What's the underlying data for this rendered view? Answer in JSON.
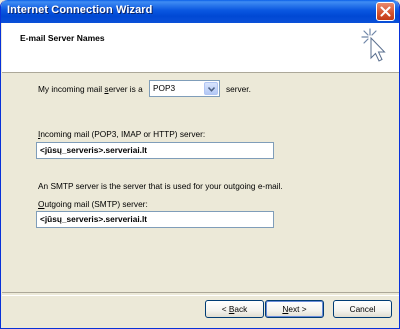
{
  "window": {
    "title": "Internet Connection Wizard"
  },
  "header": {
    "title": "E-mail Server Names"
  },
  "incoming_type": {
    "label_pre": "My incoming mail ",
    "label_accel": "s",
    "label_post": "erver is a",
    "selected": "POP3",
    "suffix": "server."
  },
  "incoming_server": {
    "label_accel": "I",
    "label_rest": "ncoming mail (POP3, IMAP or HTTP) server:",
    "value": "<jūsų_serveris>.serveriai.lt"
  },
  "smtp_info": "An SMTP server is the server that is used for your outgoing e-mail.",
  "outgoing_server": {
    "label_accel": "O",
    "label_rest": "utgoing mail (SMTP) server:",
    "value": "<jūsų_serveris>.serveriai.lt"
  },
  "buttons": {
    "back_prefix": "< ",
    "back_accel": "B",
    "back_rest": "ack",
    "next_accel": "N",
    "next_rest": "ext",
    "next_suffix": " >",
    "cancel": "Cancel"
  }
}
